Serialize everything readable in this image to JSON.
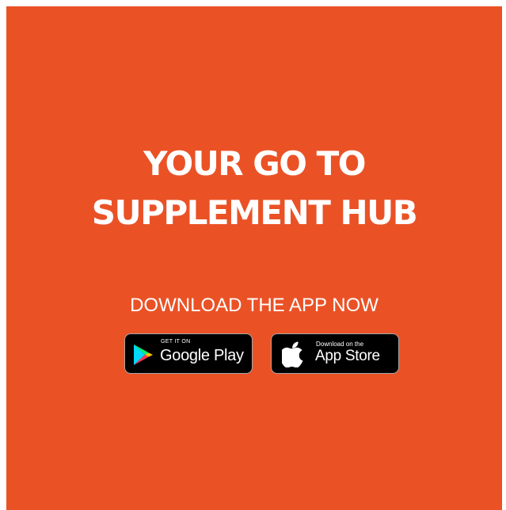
{
  "colors": {
    "background": "#ea5226",
    "text": "#ffffff",
    "badge_bg": "#000000"
  },
  "headline": {
    "line1": "YOUR GO TO",
    "line2": "SUPPLEMENT HUB"
  },
  "cta": {
    "text": "DOWNLOAD THE APP NOW"
  },
  "stores": {
    "google": {
      "icon": "google-play-icon",
      "small_label": "GET IT ON",
      "big_label": "Google Play"
    },
    "apple": {
      "icon": "apple-icon",
      "small_label": "Download on the",
      "big_label": "App Store"
    }
  }
}
